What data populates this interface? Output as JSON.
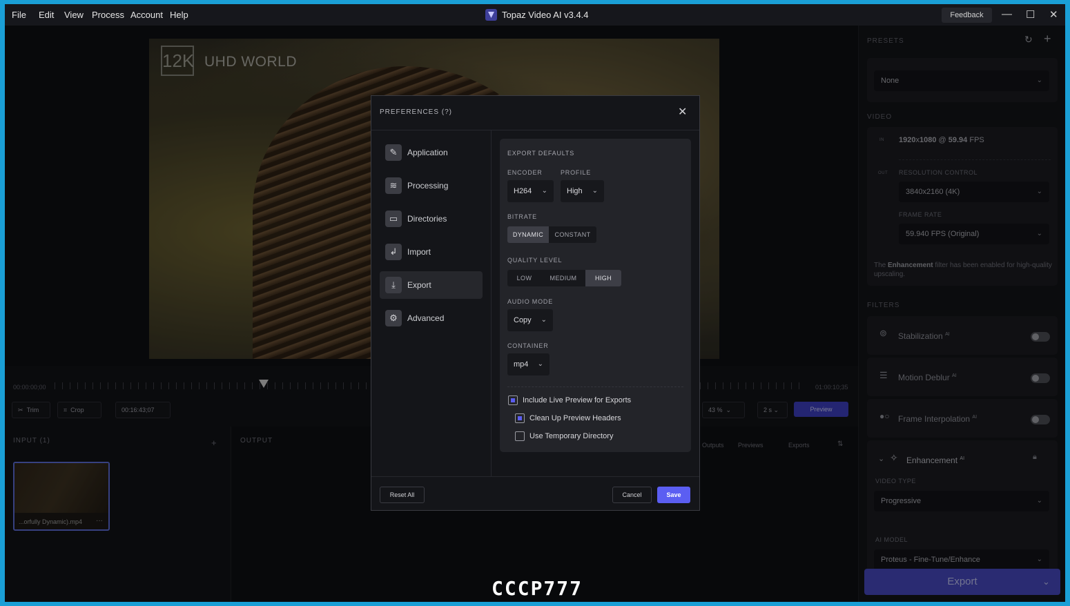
{
  "menu": [
    "File",
    "Edit",
    "View",
    "Process",
    "Account",
    "Help"
  ],
  "app_title": "Topaz Video AI  v3.4.4",
  "feedback_label": "Feedback",
  "window_controls": [
    "—",
    "☐",
    "✕"
  ],
  "preview": {
    "watermark_logo": "12K",
    "watermark_text": "UHD WORLD"
  },
  "timeline": {
    "start_time": "00:00:00;00",
    "end_time": "01:00:10;35",
    "trim_label": "Trim",
    "crop_label": "Crop",
    "current_time": "00:16:43;07",
    "zoom_value": "43 %",
    "speed_value": "2 s",
    "preview_label": "Preview"
  },
  "panels": {
    "input_label": "INPUT (1)",
    "output_label": "OUTPUT",
    "thumb_name": "...orfully Dynamic).mp4",
    "thumb_more": "···",
    "output_tabs": [
      "Outputs",
      "Previews",
      "Exports"
    ]
  },
  "sidebar": {
    "presets_label": "PRESETS",
    "preset_value": "None",
    "video_label": "VIDEO",
    "in_badge": "IN",
    "in_res": "1920",
    "in_res_x": "x",
    "in_res2": "1080",
    "in_at": "@",
    "in_fps": "59.94",
    "in_fps_unit": "FPS",
    "out_badge": "OUT",
    "resolution_control_label": "RESOLUTION CONTROL",
    "resolution_value": "3840x2160 (4K)",
    "frame_rate_label": "FRAME RATE",
    "frame_rate_value": "59.940 FPS (Original)",
    "note_pre": "The ",
    "note_bold": "Enhancement",
    "note_post": " filter has been enabled for high-quality upscaling.",
    "filters_label": "FILTERS",
    "filters": [
      {
        "name": "Stabilization",
        "badge": "AI",
        "icon": "stabilization-icon",
        "enabled": false
      },
      {
        "name": "Motion Deblur",
        "badge": "AI",
        "icon": "motion-deblur-icon",
        "enabled": false
      },
      {
        "name": "Frame Interpolation",
        "badge": "AI",
        "icon": "frame-interpolation-icon",
        "enabled": false
      }
    ],
    "enhancement_label": "Enhancement",
    "enhancement_badge": "AI",
    "video_type_label": "VIDEO TYPE",
    "video_type_value": "Progressive",
    "ai_model_label": "AI MODEL",
    "ai_model_value": "Proteus - Fine-Tune/Enhance",
    "export_label": "Export"
  },
  "dialog": {
    "title": "PREFERENCES  (?)",
    "nav": [
      {
        "label": "Application",
        "icon": "application-icon",
        "glyph": "✎",
        "active": false
      },
      {
        "label": "Processing",
        "icon": "processing-icon",
        "glyph": "≋",
        "active": false
      },
      {
        "label": "Directories",
        "icon": "folder-icon",
        "glyph": "▭",
        "active": false
      },
      {
        "label": "Import",
        "icon": "import-icon",
        "glyph": "↲",
        "active": false
      },
      {
        "label": "Export",
        "icon": "download-icon",
        "glyph": "⤓",
        "active": true
      },
      {
        "label": "Advanced",
        "icon": "advanced-icon",
        "glyph": "⚙",
        "active": false
      }
    ],
    "export_defaults_label": "EXPORT DEFAULTS",
    "encoder_label": "ENCODER",
    "encoder_value": "H264",
    "profile_label": "PROFILE",
    "profile_value": "High",
    "bitrate_label": "BITRATE",
    "bitrate_options": [
      "DYNAMIC",
      "CONSTANT"
    ],
    "bitrate_selected": "DYNAMIC",
    "quality_label": "QUALITY LEVEL",
    "quality_options": [
      "LOW",
      "MEDIUM",
      "HIGH"
    ],
    "quality_selected": "HIGH",
    "audio_mode_label": "AUDIO MODE",
    "audio_mode_value": "Copy",
    "container_label": "CONTAINER",
    "container_value": "mp4",
    "checkboxes": [
      {
        "label": "Include Live Preview for Exports",
        "checked": true
      },
      {
        "label": "Clean Up Preview Headers",
        "checked": true
      },
      {
        "label": "Use Temporary Directory",
        "checked": false
      }
    ],
    "reset_label": "Reset All",
    "cancel_label": "Cancel",
    "save_label": "Save"
  },
  "bottom_logo": "CCCP777",
  "colors": {
    "accent": "#5b5ef2",
    "export_button": "#4446b8",
    "desktop": "#1a9fd6"
  }
}
